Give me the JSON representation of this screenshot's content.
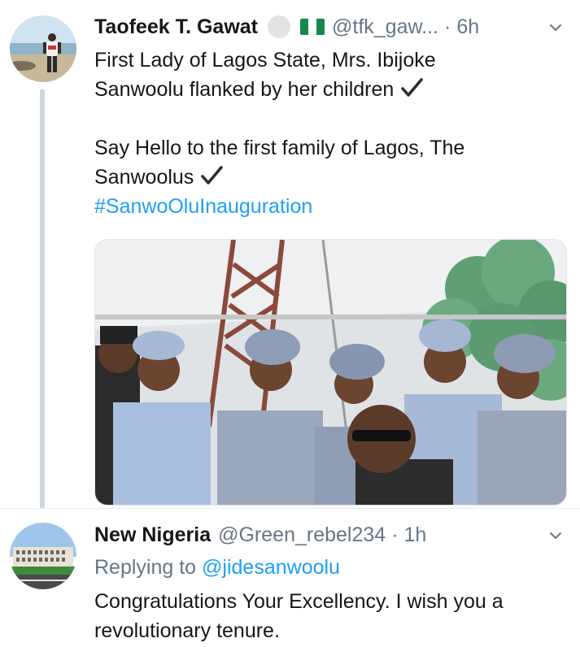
{
  "tweets": [
    {
      "author": {
        "display_name": "Taofeek T. Gawat",
        "handle": "@tfk_gaw...",
        "avatar_icon": "profile-photo-beach"
      },
      "separator": "·",
      "time": "6h",
      "text_lines": [
        "First Lady of Lagos State, Mrs. Ibijoke",
        "Sanwoolu flanked by her children",
        "",
        "Say Hello to the first family of Lagos, The",
        "Sanwoolus"
      ],
      "hashtag": "#SanwoOluInauguration",
      "media": {
        "type": "photo"
      }
    },
    {
      "author": {
        "display_name": "New Nigeria",
        "handle": "@Green_rebel234",
        "avatar_icon": "profile-photo-building"
      },
      "separator": "·",
      "time": "1h",
      "replying_to_label": "Replying to",
      "replying_to_handle": "@jidesanwoolu",
      "text_lines": [
        "Congratulations Your Excellency. I wish you a",
        "revolutionary tenure."
      ]
    }
  ],
  "colors": {
    "primary_text": "#14171a",
    "secondary_text": "#657786",
    "link": "#1da1f2",
    "thread_line": "#ccd6dd",
    "divider": "#e6ecf0"
  }
}
